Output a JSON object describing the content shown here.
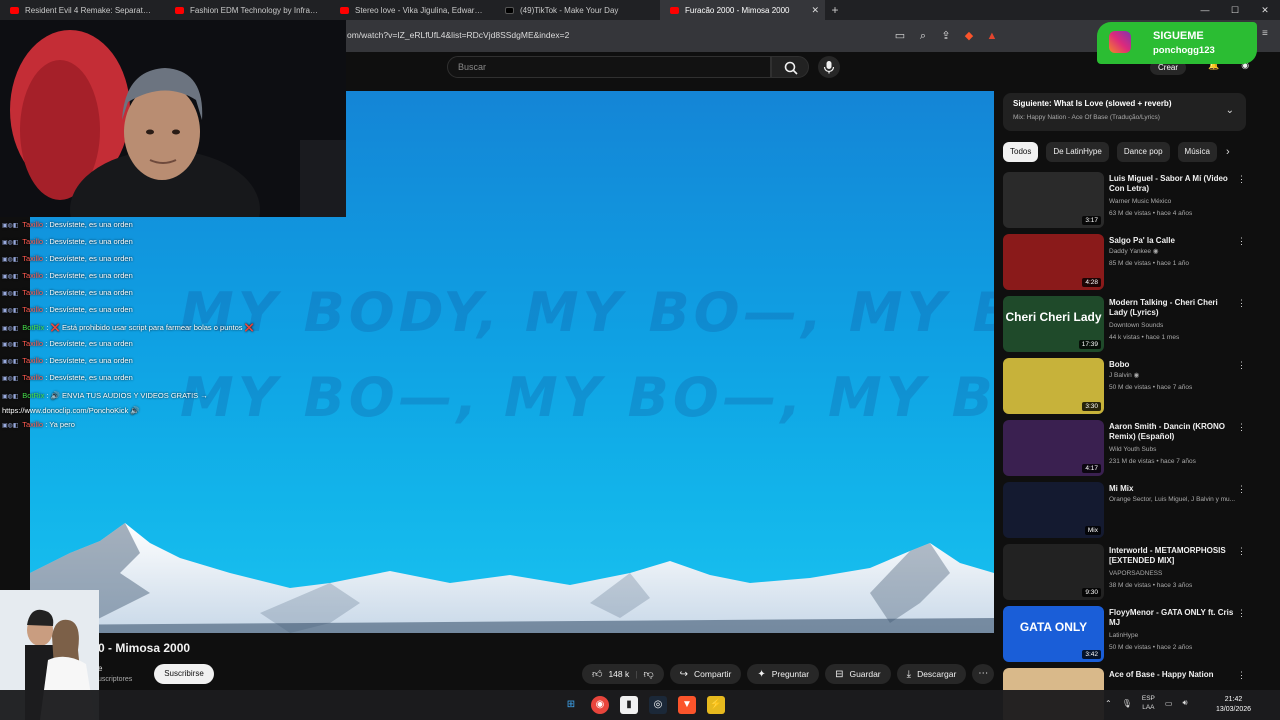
{
  "browser": {
    "tabs": [
      {
        "title": "Resident Evil 4 Remake: Separate Wa",
        "icon": "youtube-icon"
      },
      {
        "title": "Fashion EDM Technology by Infractio",
        "icon": "youtube-icon"
      },
      {
        "title": "Stereo love - Vika Jigulina, Edward m",
        "icon": "youtube-icon"
      },
      {
        "title": "(49)TikTok - Make Your Day",
        "icon": "tiktok-icon"
      },
      {
        "title": "Furacão 2000 - Mimosa 2000",
        "icon": "youtube-icon",
        "active": true
      }
    ],
    "url": "om/watch?v=IZ_eRLfUfL4&list=RDcVjd8SSdgME&index=2"
  },
  "header": {
    "search_placeholder": "Buscar",
    "create_label": "Crear"
  },
  "player": {
    "lyric_line_1": "MY BODY, MY BO—, MY BO—, MY BO—,",
    "lyric_line_2": "MY BO—, MY BO—, MY BODY GIVE IN"
  },
  "video": {
    "title": "0 - Mimosa 2000",
    "channel": "e",
    "subscribers": "uscriptores",
    "subscribe_label": "Suscribirse",
    "likes": "148 k",
    "share_label": "Compartir",
    "ask_label": "Preguntar",
    "save_label": "Guardar",
    "download_label": "Descargar"
  },
  "up_next": {
    "title": "Siguiente: What Is Love (slowed + reverb)",
    "subtitle": "Mix: Happy Nation - Ace Of Base (Tradução/Lyrics)"
  },
  "chips": [
    "Todos",
    "De LatinHype",
    "Dance pop",
    "Música"
  ],
  "recommendations": [
    {
      "title": "Luis Miguel - Sabor A Mí (Video Con Letra)",
      "channel": "Warner Music México",
      "meta": "63 M de vistas • hace 4 años",
      "duration": "3:17",
      "thumb_color": "#2a2a2a"
    },
    {
      "title": "Salgo Pa' la Calle",
      "channel": "Daddy Yankee ◉",
      "meta": "85 M de vistas • hace 1 año",
      "duration": "4:28",
      "thumb_color": "#8a1a1a"
    },
    {
      "title": "Modern Talking - Cheri Cheri Lady (Lyrics)",
      "channel": "Downtown Sounds",
      "meta": "44 k vistas • hace 1 mes",
      "duration": "17:39",
      "thumb_color": "#1f4a2a",
      "thumb_text": "Cheri Cheri Lady"
    },
    {
      "title": "Bobo",
      "channel": "J Balvin ◉",
      "meta": "50 M de vistas • hace 7 años",
      "duration": "3:30",
      "thumb_color": "#c7b23a"
    },
    {
      "title": "Aaron Smith - Dancin (KRONO Remix) (Español)",
      "channel": "Wild Youth Subs",
      "meta": "231 M de vistas • hace 7 años",
      "duration": "4:17",
      "thumb_color": "#3a2050"
    },
    {
      "title": "Mi Mix",
      "channel": "Orange Sector, Luis Miguel, J Balvin y mu...",
      "meta": "",
      "duration": "Mix",
      "thumb_color": "#141a30"
    },
    {
      "title": "Interworld - METAMORPHOSIS [EXTENDED MIX]",
      "channel": "VAPORSADNESS",
      "meta": "38 M de vistas • hace 3 años",
      "duration": "9:30",
      "thumb_color": "#222222"
    },
    {
      "title": "FloyyMenor - GATA ONLY ft. Cris MJ",
      "channel": "LatinHype",
      "meta": "50 M de vistas • hace 2 años",
      "duration": "3:42",
      "thumb_color": "#1a5ed8",
      "thumb_text": "GATA ONLY"
    },
    {
      "title": "Ace of Base - Happy Nation",
      "channel": "",
      "meta": "",
      "duration": "",
      "thumb_color": "#d9b98a"
    }
  ],
  "overlay": {
    "chat": [
      {
        "user": "Taxillo",
        "text": ": Desvístete, es una orden",
        "bot": false
      },
      {
        "user": "Taxillo",
        "text": ": Desvístete, es una orden",
        "bot": false
      },
      {
        "user": "Taxillo",
        "text": ": Desvístete, es una orden",
        "bot": false
      },
      {
        "user": "Taxillo",
        "text": ": Desvístete, es una orden",
        "bot": false
      },
      {
        "user": "Taxillo",
        "text": ": Desvístete, es una orden",
        "bot": false
      },
      {
        "user": "Taxillo",
        "text": ": Desvístete, es una orden",
        "bot": false
      },
      {
        "user": "BotRix",
        "text": ": ❌ Está prohibido usar script para farmear bolas o puntos ❌",
        "bot": true
      },
      {
        "user": "Taxillo",
        "text": ": Desvístete, es una orden",
        "bot": false
      },
      {
        "user": "Taxillo",
        "text": ": Desvístete, es una orden",
        "bot": false
      },
      {
        "user": "Taxillo",
        "text": ": Desvístete, es una orden",
        "bot": false
      },
      {
        "user": "BotRix",
        "text": ": 🔊 ENVIA TUS AUDIOS Y VIDEOS GRATIS → https://www.donoclip.com/PonchoKick 🔊",
        "bot": true
      },
      {
        "user": "Taxillo",
        "text": ": Ya pero",
        "bot": false
      }
    ],
    "social_title": "SIGUEME",
    "social_handle": "ponchogg123"
  },
  "taskbar": {
    "lang_1": "ESP",
    "lang_2": "LAA",
    "time": "21:42",
    "date": "13/03/2026"
  }
}
